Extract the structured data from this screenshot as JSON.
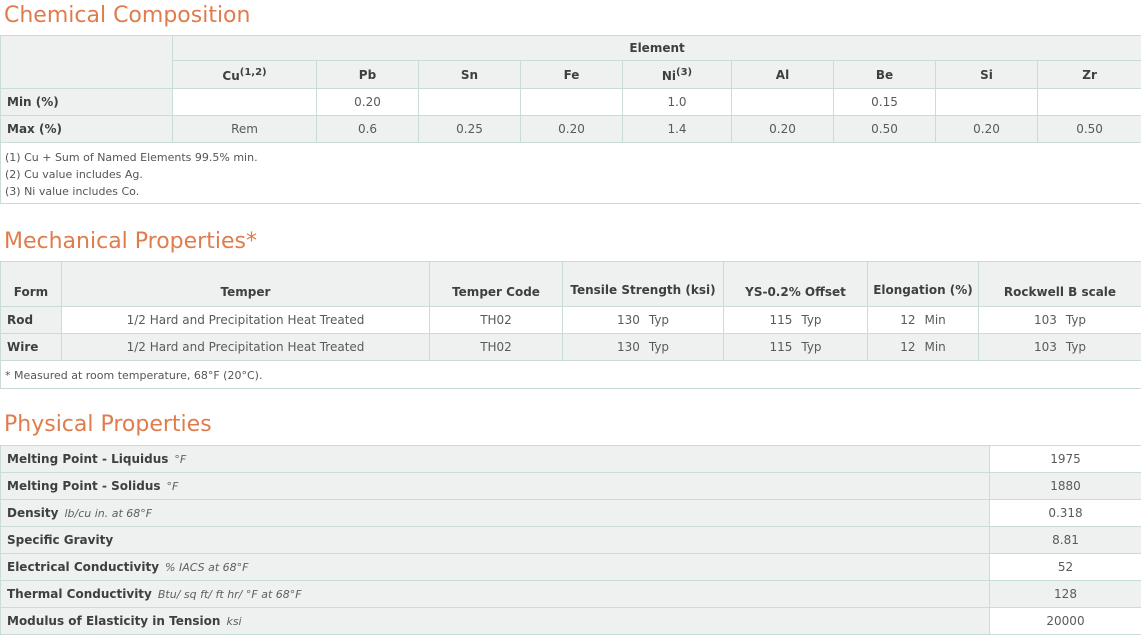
{
  "chem": {
    "title": "Chemical Composition",
    "element_header": "Element",
    "elements": [
      "Cu",
      "Pb",
      "Sn",
      "Fe",
      "Ni",
      "Al",
      "Be",
      "Si",
      "Zr"
    ],
    "element_sups": [
      "(1,2)",
      "",
      "",
      "",
      "(3)",
      "",
      "",
      "",
      ""
    ],
    "rows": [
      {
        "label": "Min (%)",
        "values": [
          "",
          "0.20",
          "",
          "",
          "1.0",
          "",
          "0.15",
          "",
          ""
        ]
      },
      {
        "label": "Max (%)",
        "values": [
          "Rem",
          "0.6",
          "0.25",
          "0.20",
          "1.4",
          "0.20",
          "0.50",
          "0.20",
          "0.50"
        ]
      }
    ],
    "notes": [
      "(1) Cu + Sum of Named Elements 99.5% min.",
      "(2) Cu value includes Ag.",
      "(3) Ni value includes Co."
    ]
  },
  "mech": {
    "title": "Mechanical Properties*",
    "headers": [
      "Form",
      "Temper",
      "Temper Code",
      "Tensile Strength (ksi)",
      "YS-0.2% Offset",
      "Elongation (%)",
      "Rockwell B scale"
    ],
    "rows": [
      {
        "form": "Rod",
        "temper": "1/2 Hard and Precipitation Heat Treated",
        "code": "TH02",
        "tensile": "130",
        "tensile_q": "Typ",
        "ys": "115",
        "ys_q": "Typ",
        "elong": "12",
        "elong_q": "Min",
        "rock": "103",
        "rock_q": "Typ"
      },
      {
        "form": "Wire",
        "temper": "1/2 Hard and Precipitation Heat Treated",
        "code": "TH02",
        "tensile": "130",
        "tensile_q": "Typ",
        "ys": "115",
        "ys_q": "Typ",
        "elong": "12",
        "elong_q": "Min",
        "rock": "103",
        "rock_q": "Typ"
      }
    ],
    "note": "* Measured at room temperature, 68°F (20°C)."
  },
  "phys": {
    "title": "Physical Properties",
    "rows": [
      {
        "name": "Melting Point - Liquidus",
        "unit": "°F",
        "value": "1975"
      },
      {
        "name": "Melting Point - Solidus",
        "unit": "°F",
        "value": "1880"
      },
      {
        "name": "Density",
        "unit": "lb/cu in. at 68°F",
        "value": "0.318"
      },
      {
        "name": "Specific Gravity",
        "unit": "",
        "value": "8.81"
      },
      {
        "name": "Electrical Conductivity",
        "unit": "% IACS at 68°F",
        "value": "52"
      },
      {
        "name": "Thermal Conductivity",
        "unit": "Btu/ sq ft/ ft hr/ °F at 68°F",
        "value": "128"
      },
      {
        "name": "Modulus of Elasticity in Tension",
        "unit": "ksi",
        "value": "20000"
      }
    ]
  }
}
